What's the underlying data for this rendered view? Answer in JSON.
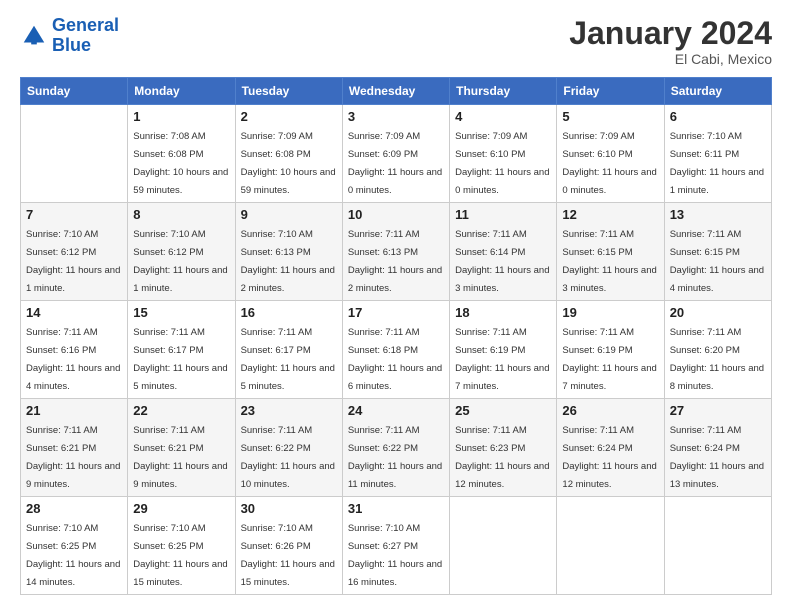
{
  "logo": {
    "line1": "General",
    "line2": "Blue"
  },
  "title": "January 2024",
  "location": "El Cabi, Mexico",
  "days_of_week": [
    "Sunday",
    "Monday",
    "Tuesday",
    "Wednesday",
    "Thursday",
    "Friday",
    "Saturday"
  ],
  "weeks": [
    [
      {
        "num": "",
        "sunrise": "",
        "sunset": "",
        "daylight": ""
      },
      {
        "num": "1",
        "sunrise": "Sunrise: 7:08 AM",
        "sunset": "Sunset: 6:08 PM",
        "daylight": "Daylight: 10 hours and 59 minutes."
      },
      {
        "num": "2",
        "sunrise": "Sunrise: 7:09 AM",
        "sunset": "Sunset: 6:08 PM",
        "daylight": "Daylight: 10 hours and 59 minutes."
      },
      {
        "num": "3",
        "sunrise": "Sunrise: 7:09 AM",
        "sunset": "Sunset: 6:09 PM",
        "daylight": "Daylight: 11 hours and 0 minutes."
      },
      {
        "num": "4",
        "sunrise": "Sunrise: 7:09 AM",
        "sunset": "Sunset: 6:10 PM",
        "daylight": "Daylight: 11 hours and 0 minutes."
      },
      {
        "num": "5",
        "sunrise": "Sunrise: 7:09 AM",
        "sunset": "Sunset: 6:10 PM",
        "daylight": "Daylight: 11 hours and 0 minutes."
      },
      {
        "num": "6",
        "sunrise": "Sunrise: 7:10 AM",
        "sunset": "Sunset: 6:11 PM",
        "daylight": "Daylight: 11 hours and 1 minute."
      }
    ],
    [
      {
        "num": "7",
        "sunrise": "Sunrise: 7:10 AM",
        "sunset": "Sunset: 6:12 PM",
        "daylight": "Daylight: 11 hours and 1 minute."
      },
      {
        "num": "8",
        "sunrise": "Sunrise: 7:10 AM",
        "sunset": "Sunset: 6:12 PM",
        "daylight": "Daylight: 11 hours and 1 minute."
      },
      {
        "num": "9",
        "sunrise": "Sunrise: 7:10 AM",
        "sunset": "Sunset: 6:13 PM",
        "daylight": "Daylight: 11 hours and 2 minutes."
      },
      {
        "num": "10",
        "sunrise": "Sunrise: 7:11 AM",
        "sunset": "Sunset: 6:13 PM",
        "daylight": "Daylight: 11 hours and 2 minutes."
      },
      {
        "num": "11",
        "sunrise": "Sunrise: 7:11 AM",
        "sunset": "Sunset: 6:14 PM",
        "daylight": "Daylight: 11 hours and 3 minutes."
      },
      {
        "num": "12",
        "sunrise": "Sunrise: 7:11 AM",
        "sunset": "Sunset: 6:15 PM",
        "daylight": "Daylight: 11 hours and 3 minutes."
      },
      {
        "num": "13",
        "sunrise": "Sunrise: 7:11 AM",
        "sunset": "Sunset: 6:15 PM",
        "daylight": "Daylight: 11 hours and 4 minutes."
      }
    ],
    [
      {
        "num": "14",
        "sunrise": "Sunrise: 7:11 AM",
        "sunset": "Sunset: 6:16 PM",
        "daylight": "Daylight: 11 hours and 4 minutes."
      },
      {
        "num": "15",
        "sunrise": "Sunrise: 7:11 AM",
        "sunset": "Sunset: 6:17 PM",
        "daylight": "Daylight: 11 hours and 5 minutes."
      },
      {
        "num": "16",
        "sunrise": "Sunrise: 7:11 AM",
        "sunset": "Sunset: 6:17 PM",
        "daylight": "Daylight: 11 hours and 5 minutes."
      },
      {
        "num": "17",
        "sunrise": "Sunrise: 7:11 AM",
        "sunset": "Sunset: 6:18 PM",
        "daylight": "Daylight: 11 hours and 6 minutes."
      },
      {
        "num": "18",
        "sunrise": "Sunrise: 7:11 AM",
        "sunset": "Sunset: 6:19 PM",
        "daylight": "Daylight: 11 hours and 7 minutes."
      },
      {
        "num": "19",
        "sunrise": "Sunrise: 7:11 AM",
        "sunset": "Sunset: 6:19 PM",
        "daylight": "Daylight: 11 hours and 7 minutes."
      },
      {
        "num": "20",
        "sunrise": "Sunrise: 7:11 AM",
        "sunset": "Sunset: 6:20 PM",
        "daylight": "Daylight: 11 hours and 8 minutes."
      }
    ],
    [
      {
        "num": "21",
        "sunrise": "Sunrise: 7:11 AM",
        "sunset": "Sunset: 6:21 PM",
        "daylight": "Daylight: 11 hours and 9 minutes."
      },
      {
        "num": "22",
        "sunrise": "Sunrise: 7:11 AM",
        "sunset": "Sunset: 6:21 PM",
        "daylight": "Daylight: 11 hours and 9 minutes."
      },
      {
        "num": "23",
        "sunrise": "Sunrise: 7:11 AM",
        "sunset": "Sunset: 6:22 PM",
        "daylight": "Daylight: 11 hours and 10 minutes."
      },
      {
        "num": "24",
        "sunrise": "Sunrise: 7:11 AM",
        "sunset": "Sunset: 6:22 PM",
        "daylight": "Daylight: 11 hours and 11 minutes."
      },
      {
        "num": "25",
        "sunrise": "Sunrise: 7:11 AM",
        "sunset": "Sunset: 6:23 PM",
        "daylight": "Daylight: 11 hours and 12 minutes."
      },
      {
        "num": "26",
        "sunrise": "Sunrise: 7:11 AM",
        "sunset": "Sunset: 6:24 PM",
        "daylight": "Daylight: 11 hours and 12 minutes."
      },
      {
        "num": "27",
        "sunrise": "Sunrise: 7:11 AM",
        "sunset": "Sunset: 6:24 PM",
        "daylight": "Daylight: 11 hours and 13 minutes."
      }
    ],
    [
      {
        "num": "28",
        "sunrise": "Sunrise: 7:10 AM",
        "sunset": "Sunset: 6:25 PM",
        "daylight": "Daylight: 11 hours and 14 minutes."
      },
      {
        "num": "29",
        "sunrise": "Sunrise: 7:10 AM",
        "sunset": "Sunset: 6:25 PM",
        "daylight": "Daylight: 11 hours and 15 minutes."
      },
      {
        "num": "30",
        "sunrise": "Sunrise: 7:10 AM",
        "sunset": "Sunset: 6:26 PM",
        "daylight": "Daylight: 11 hours and 15 minutes."
      },
      {
        "num": "31",
        "sunrise": "Sunrise: 7:10 AM",
        "sunset": "Sunset: 6:27 PM",
        "daylight": "Daylight: 11 hours and 16 minutes."
      },
      {
        "num": "",
        "sunrise": "",
        "sunset": "",
        "daylight": ""
      },
      {
        "num": "",
        "sunrise": "",
        "sunset": "",
        "daylight": ""
      },
      {
        "num": "",
        "sunrise": "",
        "sunset": "",
        "daylight": ""
      }
    ]
  ]
}
